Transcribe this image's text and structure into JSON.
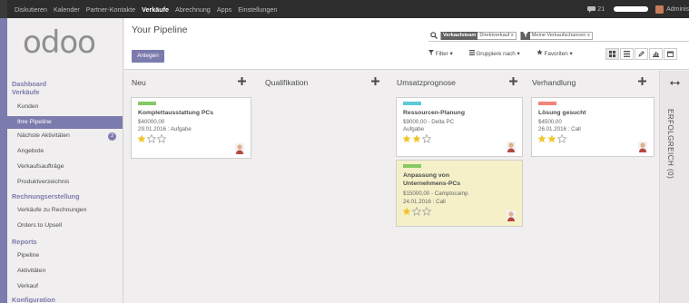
{
  "topbar": {
    "menu": [
      "Diskutieren",
      "Kalender",
      "Partner-Kontakte",
      "Verkäufe",
      "Abrechnung",
      "Apps",
      "Einstellungen"
    ],
    "active_index": 3,
    "chat_count": "21",
    "user_name": "Adminis"
  },
  "app": {
    "logo_text": "odoo",
    "brand_color": "#7c7bad"
  },
  "sidebar": {
    "sec_dashboard": "Dashboard",
    "sec_sales": "Verkäufe",
    "item_customers": "Kunden",
    "item_pipeline": "Ihre Pipeline",
    "item_activities": "Nächste Aktivitäten",
    "activities_badge": "3",
    "item_quotes": "Angebote",
    "item_orders": "Verkaufsaufträge",
    "item_products": "Produktverzeichnis",
    "sec_invoicing": "Rechnungserstellung",
    "item_to_invoice": "Verkäufe zu Rechnungen",
    "item_upsell": "Orders to Upsell",
    "sec_reports": "Reports",
    "item_rep_pipeline": "Pipeline",
    "item_rep_activities": "Aktivitäten",
    "item_rep_sales": "Verkauf",
    "sec_config": "Konfiguration"
  },
  "control": {
    "breadcrumb": "Your Pipeline",
    "create_label": "Anlegen",
    "facet1_label": "Verkaufsteam",
    "facet1_value": "Direktverkauf x",
    "facet2_value": "Meine Verkaufschancen x",
    "filter_label": "Filter ▾",
    "group_label": "Gruppiere nach ▾",
    "fav_label": "Favoriten ▾",
    "view_icons": [
      "kanban-view-icon",
      "list-view-icon",
      "form-view-icon",
      "graph-view-icon",
      "calendar-view-icon"
    ]
  },
  "kanban": {
    "col_new": "Neu",
    "col_qual": "Qualifikation",
    "col_forecast": "Umsatzprognose",
    "col_nego": "Verhandlung",
    "col_won": "ERFOLGREICH (0)",
    "cards": {
      "c1": {
        "title": "Komplettausstattung PCs",
        "amount": "$40000,00",
        "date": "29.01.2016 : Aufgabe",
        "stars": 1,
        "tag_color": "#85c963"
      },
      "c2": {
        "title": "Ressourcen-Planung",
        "amount": "$9000,00 - Delta PC",
        "date": "Aufgabe",
        "stars": 2,
        "tag_color": "#5cc9d6"
      },
      "c3": {
        "title": "Anpassung von Unternehmens-PCs",
        "amount": "$15000,00 - Camptocamp",
        "date": "24.01.2016 : Call",
        "stars": 1,
        "tag_color": "#85c963",
        "bg_color": "#f5f0c8"
      },
      "c4": {
        "title": "Lösung gesucht",
        "amount": "$4500,00",
        "date": "26.01.2016 : Call",
        "stars": 2,
        "tag_color": "#f2847b"
      }
    },
    "star_color": "#f0c52b",
    "star_empty_color": "#a6a6a6"
  }
}
